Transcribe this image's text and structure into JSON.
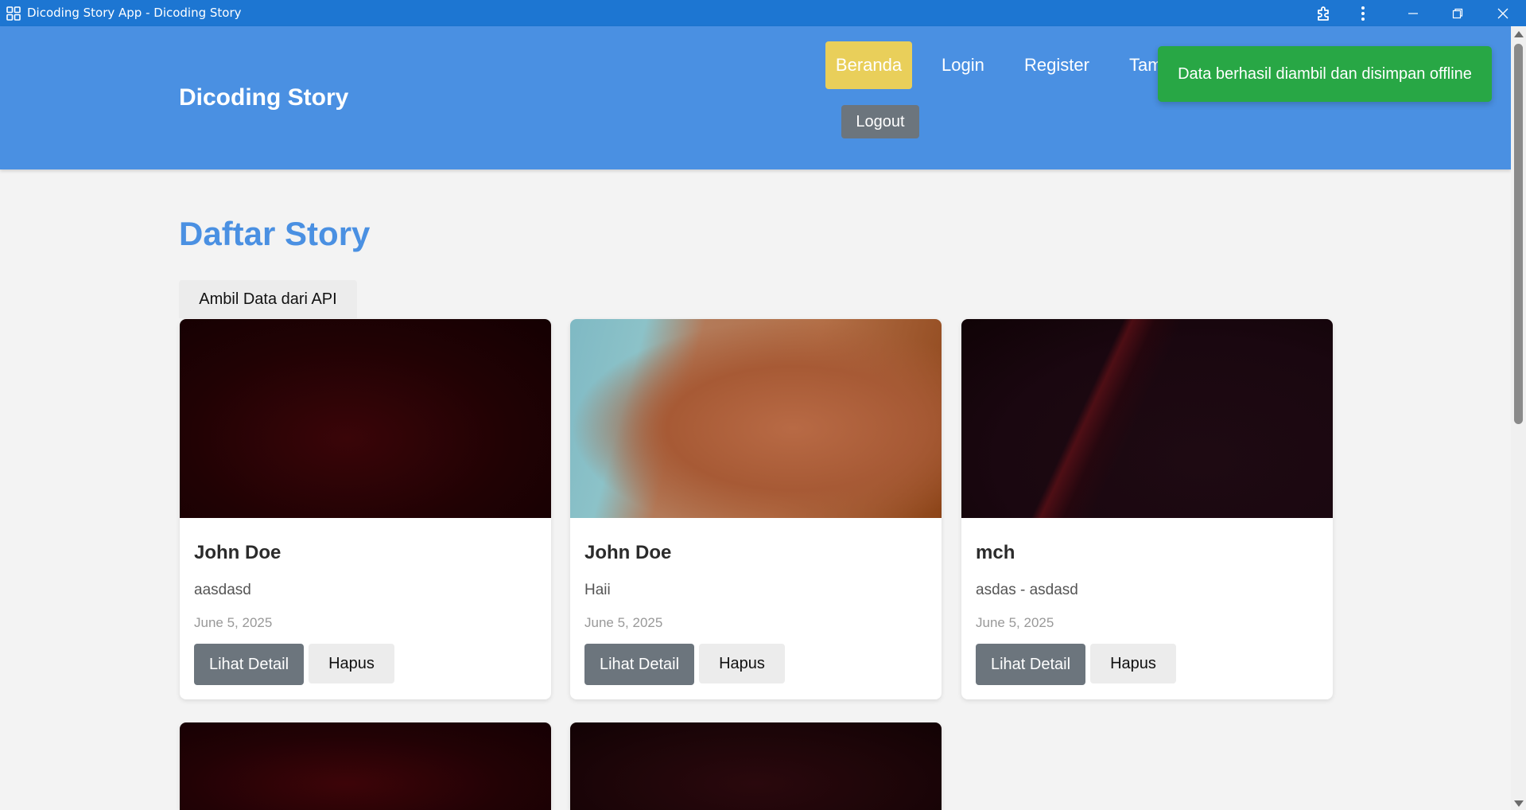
{
  "window": {
    "title": "Dicoding Story App - Dicoding Story",
    "icons": [
      "app-grid-icon",
      "extension-icon",
      "more-vert-icon",
      "minimize-icon",
      "restore-icon",
      "close-icon"
    ]
  },
  "header": {
    "brand": "Dicoding Story",
    "nav": [
      {
        "label": "Beranda",
        "active": true
      },
      {
        "label": "Login"
      },
      {
        "label": "Register"
      },
      {
        "label": "Tam"
      }
    ],
    "logout_label": "Logout",
    "colors": {
      "header": "#4a90e2",
      "active": "#e9cf5a"
    }
  },
  "toast": {
    "message": "Data berhasil diambil dan disimpan offline",
    "color": "#28a745"
  },
  "main": {
    "title": "Daftar Story",
    "fetch_label": "Ambil Data dari API",
    "stories": [
      {
        "name": "John Doe",
        "description": "aasdasd",
        "date": "June 5, 2025",
        "detail_label": "Lihat Detail",
        "delete_label": "Hapus"
      },
      {
        "name": "John Doe",
        "description": "Haii",
        "date": "June 5, 2025",
        "detail_label": "Lihat Detail",
        "delete_label": "Hapus"
      },
      {
        "name": "mch",
        "description": "asdas - asdasd",
        "date": "June 5, 2025",
        "detail_label": "Lihat Detail",
        "delete_label": "Hapus"
      }
    ]
  }
}
